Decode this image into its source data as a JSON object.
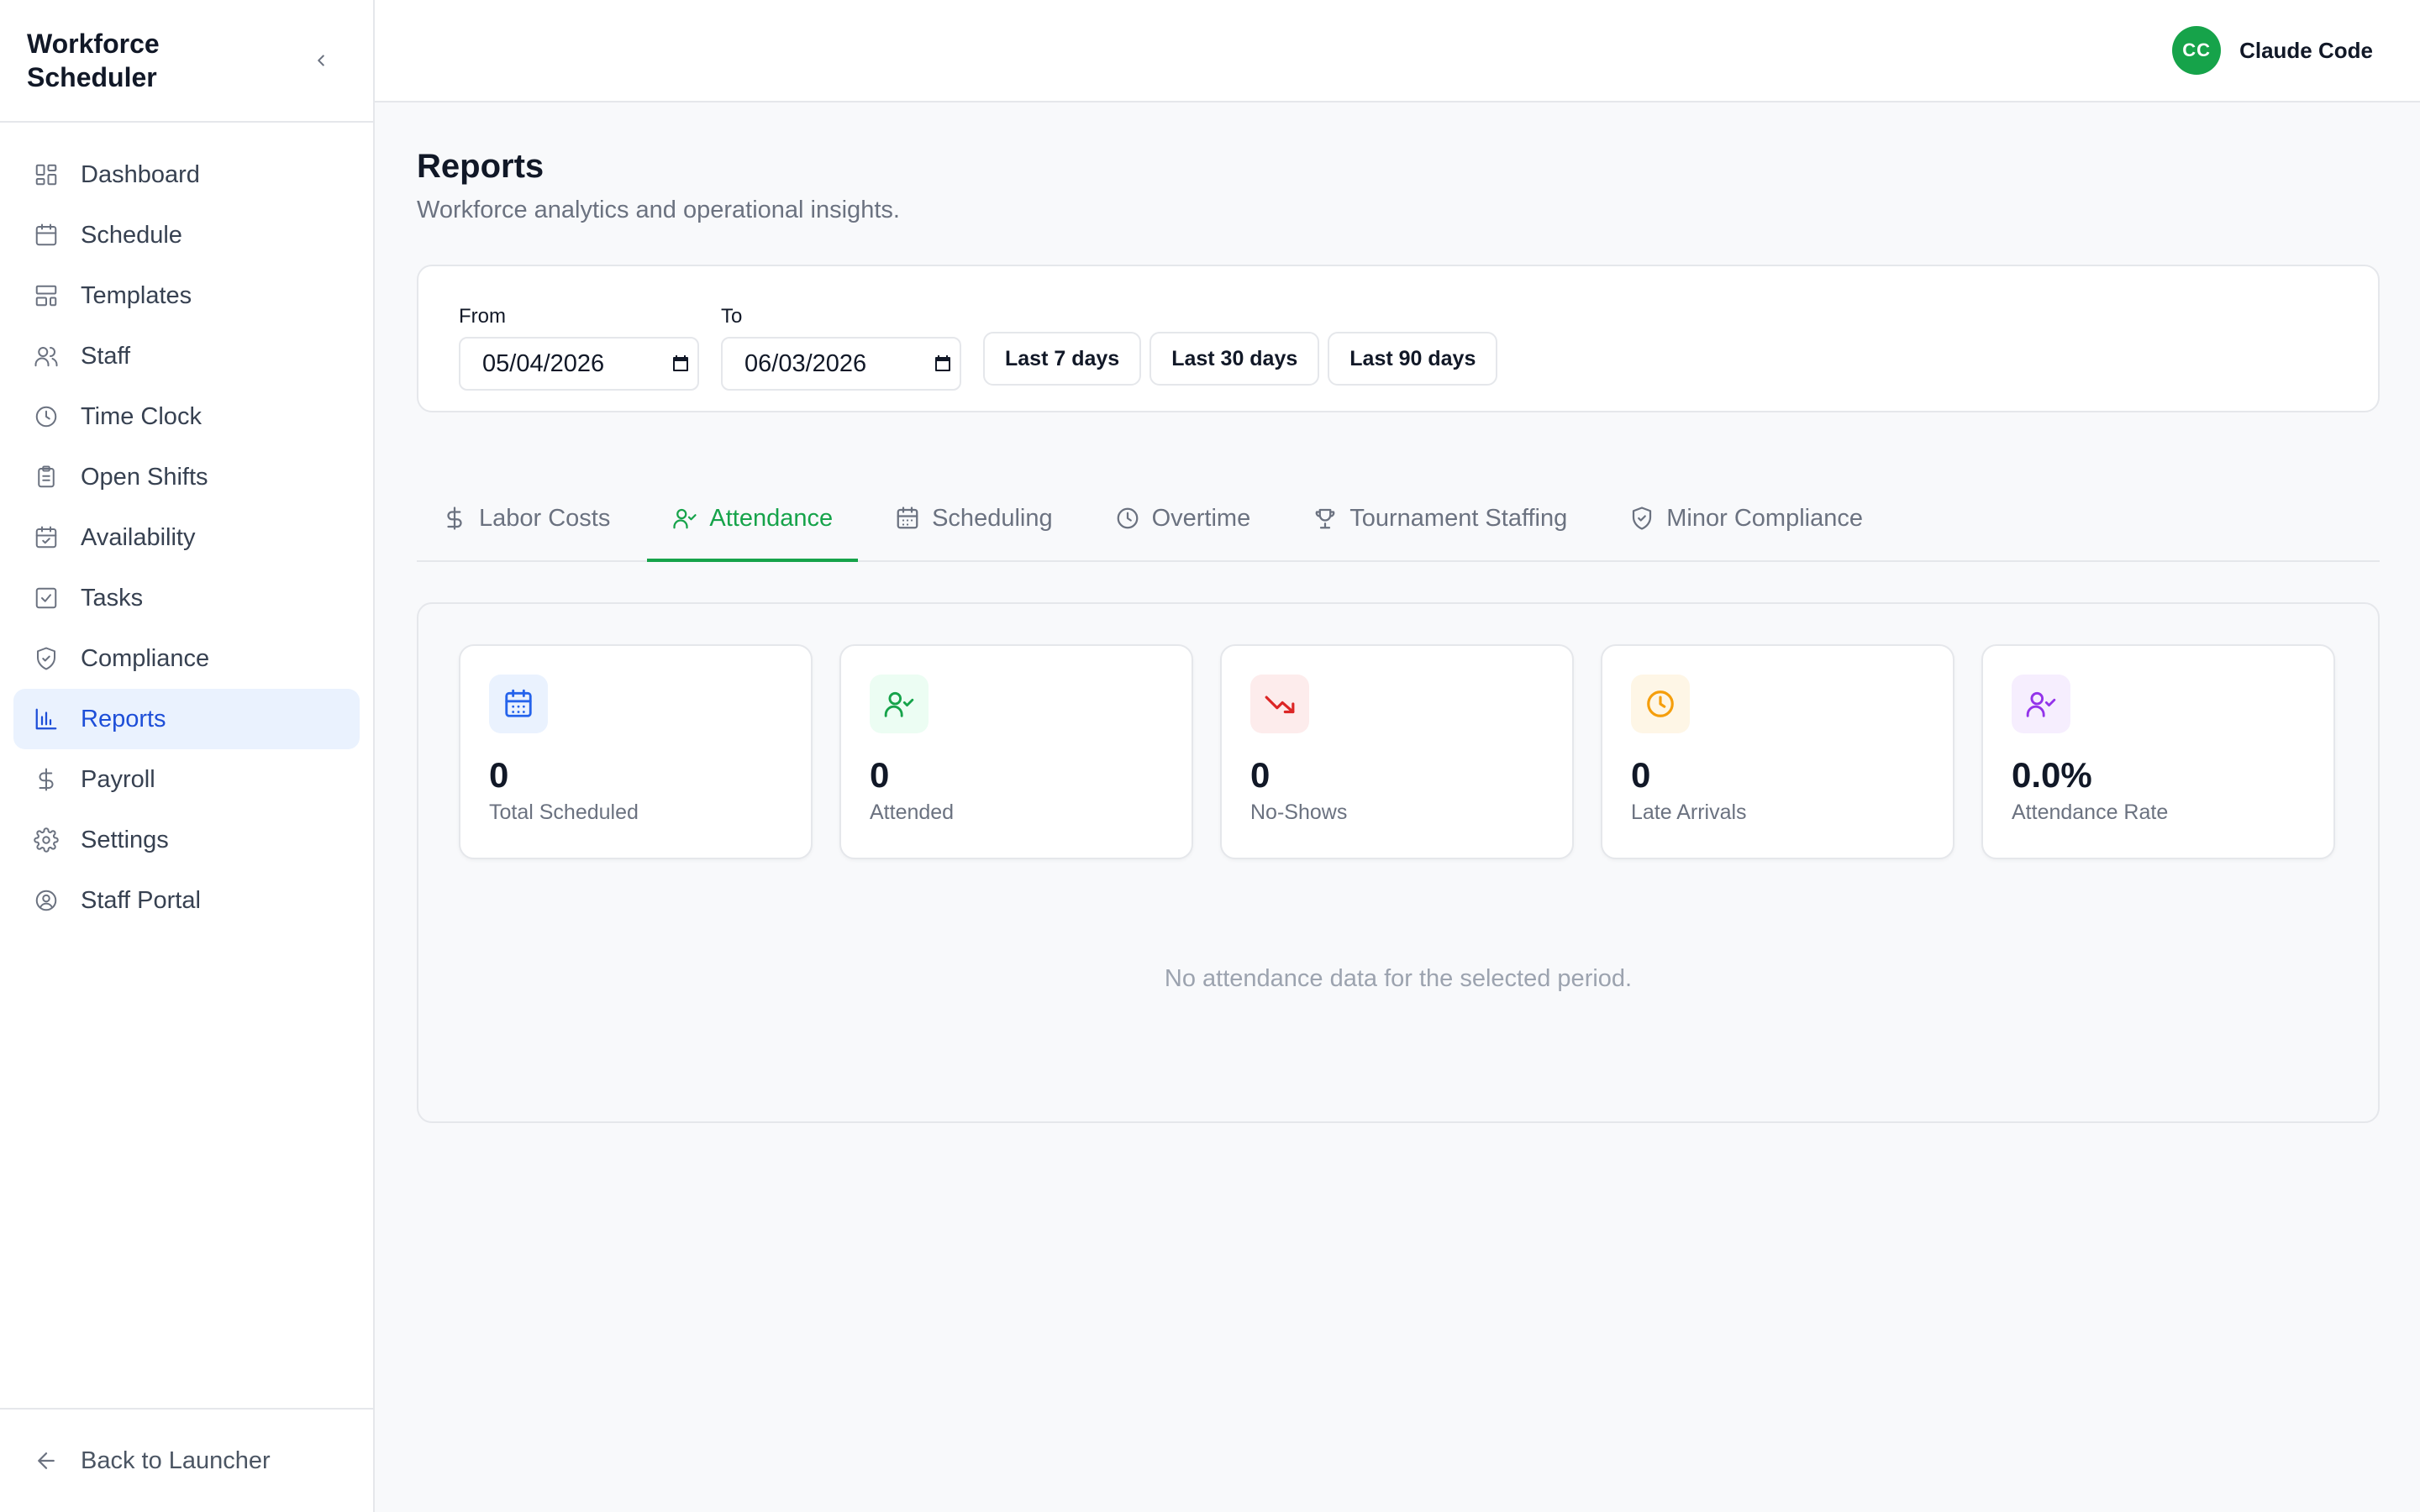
{
  "app": {
    "title": "Workforce Scheduler"
  },
  "sidebar": {
    "items": [
      {
        "label": "Dashboard",
        "icon": "grid-icon"
      },
      {
        "label": "Schedule",
        "icon": "calendar-icon"
      },
      {
        "label": "Templates",
        "icon": "layout-icon"
      },
      {
        "label": "Staff",
        "icon": "users-icon"
      },
      {
        "label": "Time Clock",
        "icon": "clock-icon"
      },
      {
        "label": "Open Shifts",
        "icon": "clipboard-icon"
      },
      {
        "label": "Availability",
        "icon": "calendar-check-icon"
      },
      {
        "label": "Tasks",
        "icon": "checkbox-icon"
      },
      {
        "label": "Compliance",
        "icon": "shield-icon"
      },
      {
        "label": "Reports",
        "icon": "bar-chart-icon",
        "active": true
      },
      {
        "label": "Payroll",
        "icon": "dollar-icon"
      },
      {
        "label": "Settings",
        "icon": "gear-icon"
      },
      {
        "label": "Staff Portal",
        "icon": "user-circle-icon"
      }
    ],
    "footer_label": "Back to Launcher"
  },
  "header": {
    "avatar_initials": "CC",
    "user_name": "Claude Code"
  },
  "page": {
    "title": "Reports",
    "subtitle": "Workforce analytics and operational insights."
  },
  "filters": {
    "from_label": "From",
    "from_value": "05/04/2026",
    "to_label": "To",
    "to_value": "06/03/2026",
    "quick": [
      "Last 7 days",
      "Last 30 days",
      "Last 90 days"
    ]
  },
  "tabs": [
    {
      "label": "Labor Costs",
      "icon": "dollar-icon"
    },
    {
      "label": "Attendance",
      "icon": "user-check-icon",
      "active": true
    },
    {
      "label": "Scheduling",
      "icon": "calendar-icon"
    },
    {
      "label": "Overtime",
      "icon": "clock-icon"
    },
    {
      "label": "Tournament Staffing",
      "icon": "trophy-icon"
    },
    {
      "label": "Minor Compliance",
      "icon": "shield-check-icon"
    }
  ],
  "stats": [
    {
      "value": "0",
      "label": "Total Scheduled",
      "icon": "calendar-icon",
      "color": "#2563eb",
      "bg": "#eaf2fe"
    },
    {
      "value": "0",
      "label": "Attended",
      "icon": "user-check-icon",
      "color": "#16a34a",
      "bg": "#ecfdf3"
    },
    {
      "value": "0",
      "label": "No-Shows",
      "icon": "trending-down-icon",
      "color": "#dc2626",
      "bg": "#fdecec"
    },
    {
      "value": "0",
      "label": "Late Arrivals",
      "icon": "clock-icon",
      "color": "#f59e0b",
      "bg": "#fef6e6"
    },
    {
      "value": "0.0%",
      "label": "Attendance Rate",
      "icon": "user-check-icon",
      "color": "#9333ea",
      "bg": "#f6eefe"
    }
  ],
  "empty_message": "No attendance data for the selected period.",
  "colors": {
    "accent": "#1d4ed8",
    "active_tab": "#16a34a",
    "avatar_bg": "#16a34a"
  }
}
